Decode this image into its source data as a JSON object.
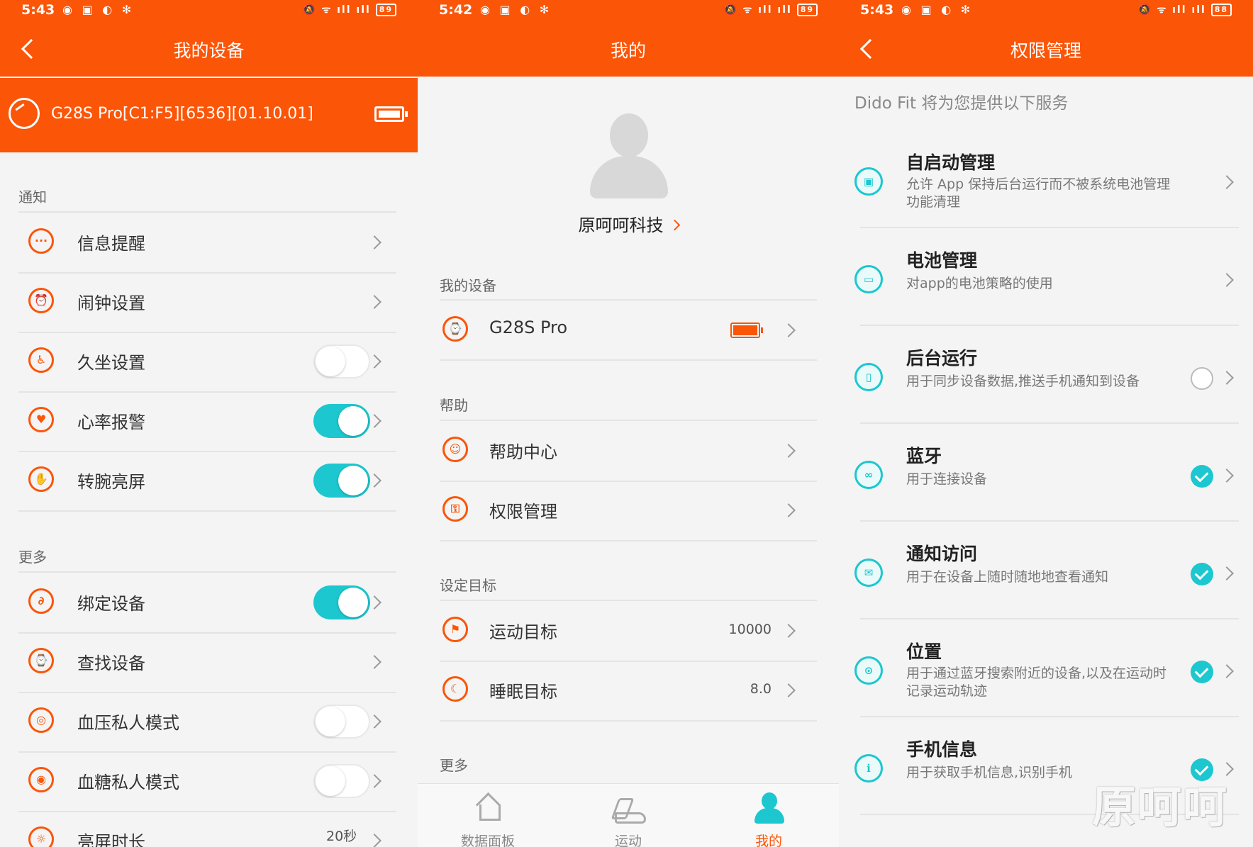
{
  "colors": {
    "accent": "#fb5508",
    "teal": "#1cc7cf"
  },
  "panel1": {
    "status": {
      "time": "5:43",
      "battery": "89"
    },
    "title": "我的设备",
    "device_name": "G28S Pro[C1:F5][6536][01.10.01]",
    "sections": {
      "notify": "通知",
      "more": "更多"
    },
    "rows": [
      {
        "label": "信息提醒",
        "icon": "message-icon",
        "control": "chevron"
      },
      {
        "label": "闹钟设置",
        "icon": "alarm-icon",
        "control": "chevron"
      },
      {
        "label": "久坐设置",
        "icon": "sedentary-icon",
        "control": "toggle-off"
      },
      {
        "label": "心率报警",
        "icon": "heart-icon",
        "control": "toggle-on"
      },
      {
        "label": "转腕亮屏",
        "icon": "wrist-icon",
        "control": "toggle-on"
      },
      {
        "label": "绑定设备",
        "icon": "link-icon",
        "control": "toggle-on"
      },
      {
        "label": "查找设备",
        "icon": "find-icon",
        "control": "chevron"
      },
      {
        "label": "血压私人模式",
        "icon": "blood-pressure-icon",
        "control": "toggle-off"
      },
      {
        "label": "血糖私人模式",
        "icon": "blood-sugar-icon",
        "control": "toggle-off"
      },
      {
        "label": "亮屏时长",
        "icon": "screen-time-icon",
        "control": "value",
        "value": "20秒"
      }
    ]
  },
  "panel2": {
    "status": {
      "time": "5:42",
      "battery": "89"
    },
    "title": "我的",
    "username": "原呵呵科技",
    "sections": {
      "device": "我的设备",
      "help": "帮助",
      "goals": "设定目标",
      "more": "更多"
    },
    "device": {
      "name": "G28S Pro"
    },
    "help_rows": [
      {
        "label": "帮助中心",
        "icon": "help-center-icon"
      },
      {
        "label": "权限管理",
        "icon": "permission-icon"
      }
    ],
    "goal_rows": [
      {
        "label": "运动目标",
        "icon": "sport-goal-icon",
        "value": "10000"
      },
      {
        "label": "睡眠目标",
        "icon": "sleep-goal-icon",
        "value": "8.0"
      }
    ],
    "nav": [
      {
        "label": "数据面板",
        "icon": "home-icon"
      },
      {
        "label": "运动",
        "icon": "shoe-icon"
      },
      {
        "label": "我的",
        "icon": "profile-icon"
      }
    ]
  },
  "panel3": {
    "status": {
      "time": "5:43",
      "battery": "88"
    },
    "title": "权限管理",
    "intro": "Dido Fit 将为您提供以下服务",
    "items": [
      {
        "title": "自启动管理",
        "desc": "允许 App 保持后台运行而不被系统电池管理功能清理",
        "icon": "autostart-icon",
        "state": "chevron"
      },
      {
        "title": "电池管理",
        "desc": "对app的电池策略的使用",
        "icon": "battery-icon",
        "state": "chevron"
      },
      {
        "title": "后台运行",
        "desc": "用于同步设备数据,推送手机通知到设备",
        "icon": "background-icon",
        "state": "unchecked"
      },
      {
        "title": "蓝牙",
        "desc": "用于连接设备",
        "icon": "bluetooth-icon",
        "state": "checked"
      },
      {
        "title": "通知访问",
        "desc": "用于在设备上随时随地地查看通知",
        "icon": "notification-icon",
        "state": "checked"
      },
      {
        "title": "位置",
        "desc": "用于通过蓝牙搜索附近的设备,以及在运动时记录运动轨迹",
        "icon": "location-icon",
        "state": "checked"
      },
      {
        "title": "手机信息",
        "desc": "用于获取手机信息,识别手机",
        "icon": "phone-info-icon",
        "state": "checked"
      }
    ],
    "watermark": "原呵呵"
  }
}
